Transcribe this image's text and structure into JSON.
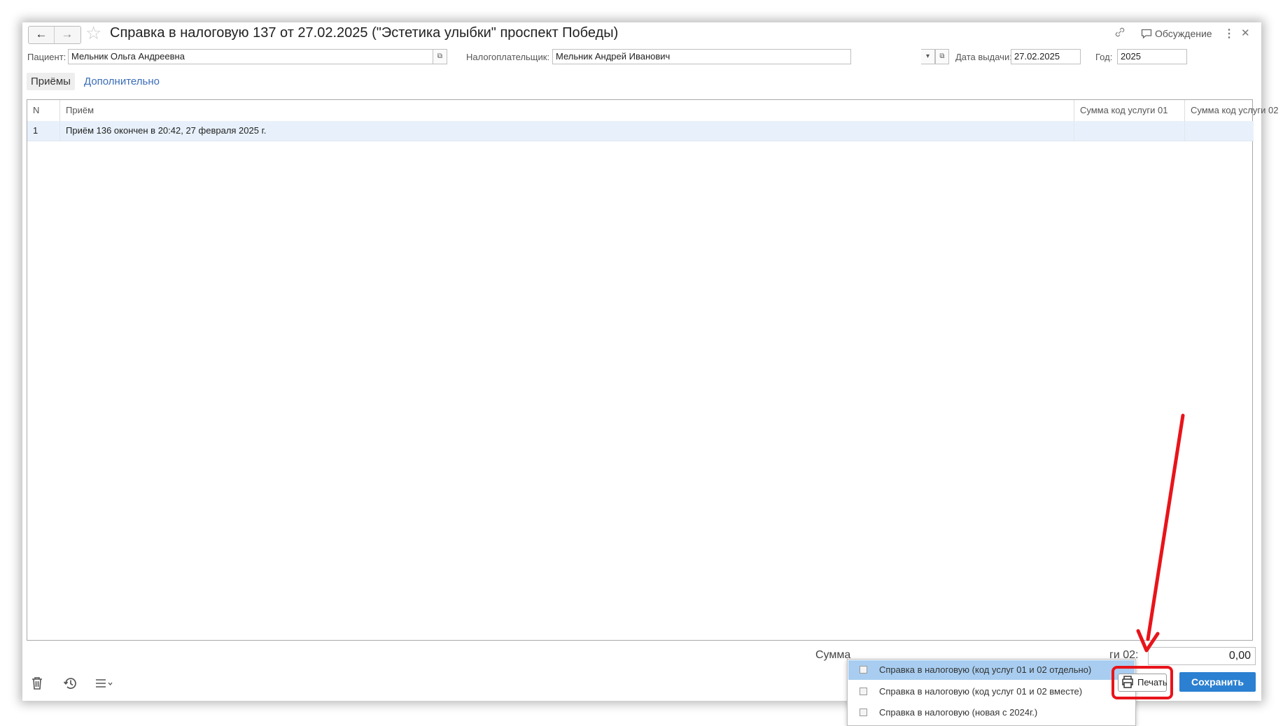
{
  "header": {
    "title": "Справка в налоговую 137 от 27.02.2025 (\"Эстетика улыбки\" проспект Победы)",
    "discuss_label": "Обсуждение"
  },
  "fields": {
    "patient_label": "Пациент:",
    "patient_value": "Мельник Ольга Андреевна",
    "payer_label": "Налогоплательщик:",
    "payer_value": "Мельник Андрей Иванович",
    "date_label": "Дата выдачи:",
    "date_value": "27.02.2025",
    "year_label": "Год:",
    "year_value": "2025"
  },
  "tabs": [
    {
      "label": "Приёмы",
      "active": true
    },
    {
      "label": "Дополнительно",
      "active": false
    }
  ],
  "table": {
    "columns": [
      "N",
      "Приём",
      "Сумма код услуги 01",
      "Сумма код услуги 02"
    ],
    "rows": [
      [
        "1",
        "Приём 136 окончен в 20:42, 27 февраля 2025 г.",
        "",
        ""
      ]
    ]
  },
  "footer": {
    "sum_label_left": "Сумма",
    "sum_label_right": "ги 02:",
    "sum_value": "0,00",
    "print_label": "Печать",
    "save_label": "Сохранить"
  },
  "print_menu": {
    "items": [
      {
        "label": "Справка в налоговую (код услуг 01 и 02 отдельно)",
        "selected": true
      },
      {
        "label": "Справка в налоговую (код услуг 01 и 02 вместе)",
        "selected": false
      },
      {
        "label": "Справка в налоговую (новая с 2024г.)",
        "selected": false
      }
    ]
  },
  "icons": {
    "back": "arrow-left-icon",
    "forward": "arrow-right-icon",
    "favorite": "star-icon",
    "link": "link-icon",
    "discuss": "speech-bubble-icon",
    "more": "more-vertical-icon",
    "close": "close-icon",
    "open": "open-form-icon",
    "dropdown": "chevron-down-icon",
    "delete": "trash-icon",
    "history": "history-icon",
    "menu": "list-menu-icon",
    "print": "printer-icon"
  },
  "colors": {
    "accent": "#2b80d1",
    "link": "#3b6db8",
    "selected_row": "#e8f1fb",
    "menu_selected": "#a8cdf0",
    "annotation": "#e8141a"
  }
}
